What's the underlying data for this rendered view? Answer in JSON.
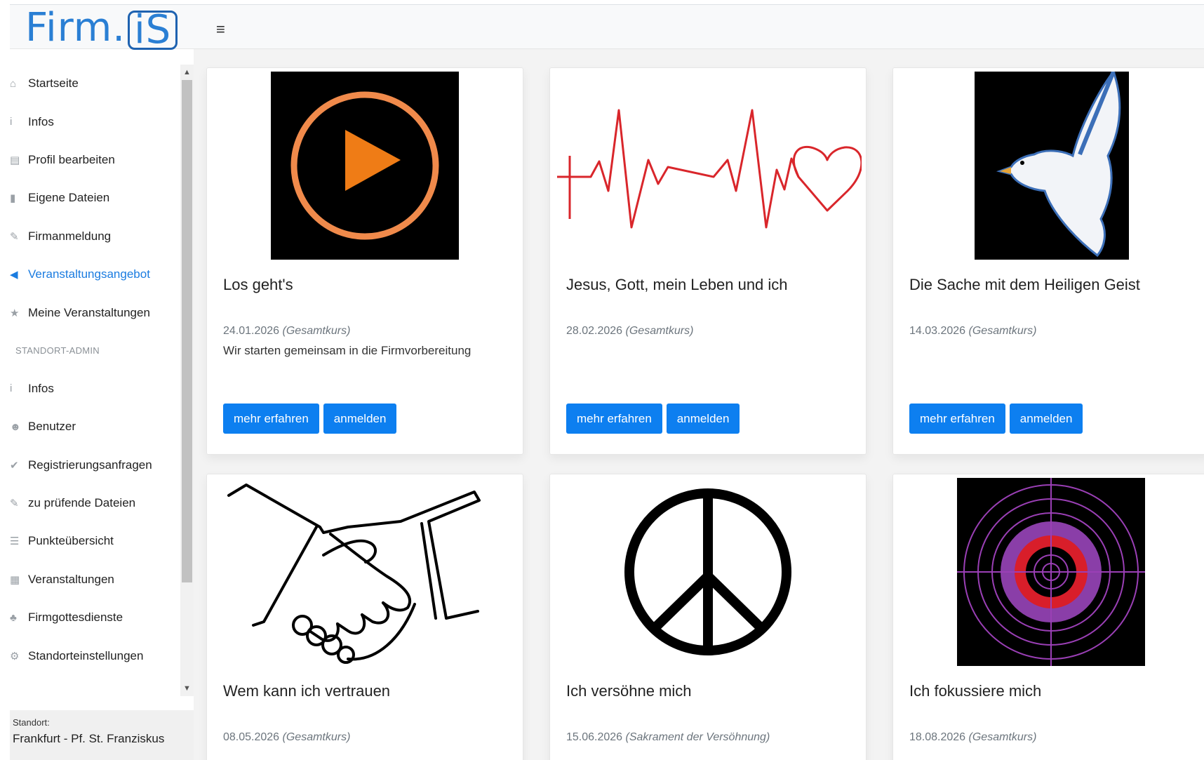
{
  "header": {
    "logo_main": "Firm.",
    "logo_box": "iS",
    "menu_icon": "hamburger-icon",
    "menu_glyph": "≡"
  },
  "sidebar": {
    "items": [
      {
        "label": "Startseite",
        "icon": "home-icon",
        "glyph": "⌂"
      },
      {
        "label": "Infos",
        "icon": "info-icon",
        "glyph": "i"
      },
      {
        "label": "Profil bearbeiten",
        "icon": "id-card-icon",
        "glyph": "▤"
      },
      {
        "label": "Eigene Dateien",
        "icon": "file-icon",
        "glyph": "▮"
      },
      {
        "label": "Firmanmeldung",
        "icon": "edit-icon",
        "glyph": "✎"
      },
      {
        "label": "Veranstaltungsangebot",
        "icon": "megaphone-icon",
        "glyph": "◀"
      },
      {
        "label": "Meine Veranstaltungen",
        "icon": "star-icon",
        "glyph": "★"
      }
    ],
    "section_label": "STANDORT-ADMIN",
    "admin_items": [
      {
        "label": "Infos",
        "icon": "info-icon",
        "glyph": "i"
      },
      {
        "label": "Benutzer",
        "icon": "users-icon",
        "glyph": "☻"
      },
      {
        "label": "Registrierungsanfragen",
        "icon": "user-check-icon",
        "glyph": "✔"
      },
      {
        "label": "zu prüfende Dateien",
        "icon": "edit-icon",
        "glyph": "✎"
      },
      {
        "label": "Punkteübersicht",
        "icon": "list-icon",
        "glyph": "☰"
      },
      {
        "label": "Veranstaltungen",
        "icon": "calendar-icon",
        "glyph": "▦"
      },
      {
        "label": "Firmgottesdienste",
        "icon": "sitemap-icon",
        "glyph": "♣"
      },
      {
        "label": "Standorteinstellungen",
        "icon": "cogs-icon",
        "glyph": "⚙"
      }
    ],
    "active_index": 5,
    "standort_label": "Standort:",
    "standort_value": "Frankfurt - Pf. St. Franziskus"
  },
  "events": [
    {
      "title": "Los geht's",
      "date": "24.01.2026",
      "type": "(Gesamtkurs)",
      "description": "Wir starten gemeinsam in die Firmvorbereitung",
      "image": "play-button-image",
      "more": "mehr erfahren",
      "register": "anmelden"
    },
    {
      "title": "Jesus, Gott, mein Leben und ich",
      "date": "28.02.2026",
      "type": "(Gesamtkurs)",
      "description": "",
      "image": "heartbeat-image",
      "more": "mehr erfahren",
      "register": "anmelden"
    },
    {
      "title": "Die Sache mit dem Heiligen Geist",
      "date": "14.03.2026",
      "type": "(Gesamtkurs)",
      "description": "",
      "image": "dove-image",
      "more": "mehr erfahren",
      "register": "anmelden"
    },
    {
      "title": "Wem kann ich vertrauen",
      "date": "08.05.2026",
      "type": "(Gesamtkurs)",
      "description": "",
      "image": "handshake-image"
    },
    {
      "title": "Ich versöhne mich",
      "date": "15.06.2026",
      "type": "(Sakrament der Versöhnung)",
      "description": "",
      "image": "peace-sign-image"
    },
    {
      "title": "Ich fokussiere mich",
      "date": "18.08.2026",
      "type": "(Gesamtkurs)",
      "description": "",
      "image": "target-image"
    }
  ],
  "colors": {
    "accent": "#0d7ff0",
    "active_link": "#1b7ce0",
    "logo": "#2a7fd4"
  }
}
